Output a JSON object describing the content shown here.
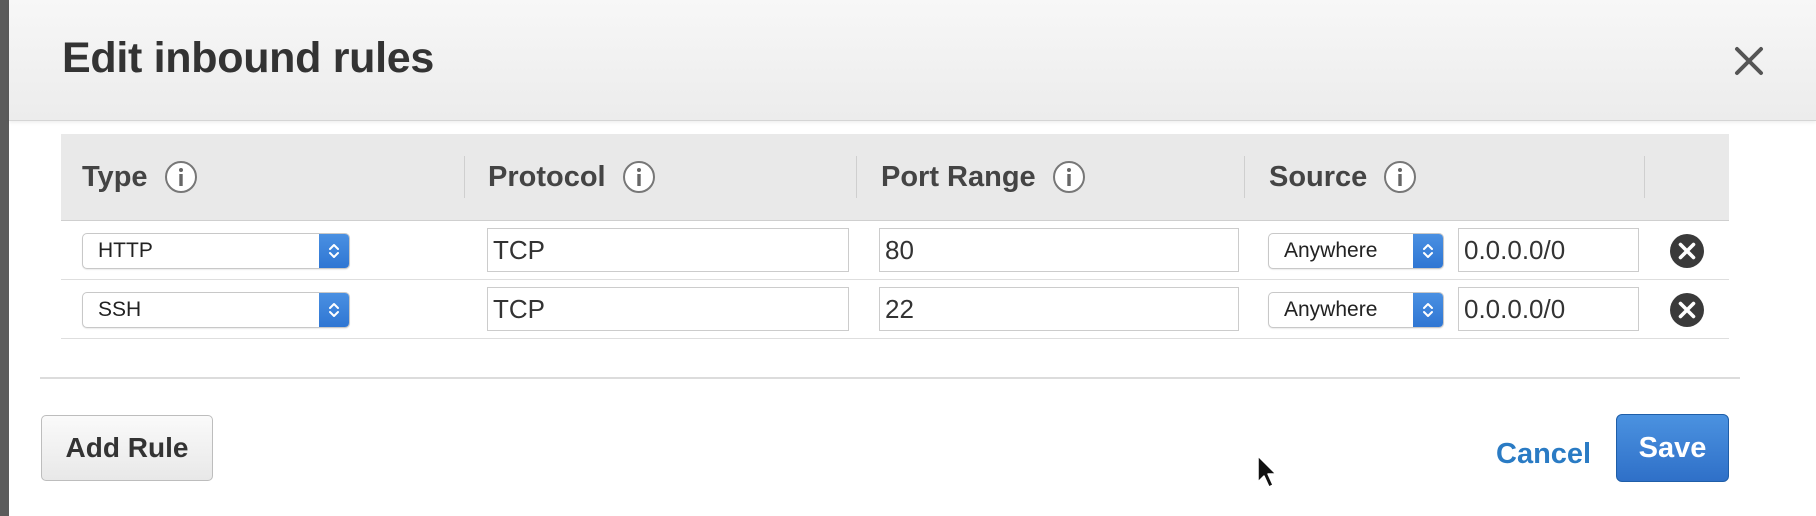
{
  "dialog": {
    "title": "Edit inbound rules",
    "close_icon": "close-icon"
  },
  "table": {
    "columns": [
      {
        "label": "Type",
        "icon": "info-icon"
      },
      {
        "label": "Protocol",
        "icon": "info-icon"
      },
      {
        "label": "Port Range",
        "icon": "info-icon"
      },
      {
        "label": "Source",
        "icon": "info-icon"
      }
    ],
    "rows": [
      {
        "type": "HTTP",
        "protocol": "TCP",
        "port_range": "80",
        "source": "Anywhere",
        "cidr": "0.0.0.0/0",
        "remove_icon": "remove-circle-icon"
      },
      {
        "type": "SSH",
        "protocol": "TCP",
        "port_range": "22",
        "source": "Anywhere",
        "cidr": "0.0.0.0/0",
        "remove_icon": "remove-circle-icon"
      }
    ]
  },
  "footer": {
    "add_rule_label": "Add Rule",
    "cancel_label": "Cancel",
    "save_label": "Save"
  },
  "colors": {
    "primary_button": "#3a80d6",
    "link": "#2a7bc4",
    "select_arrow": "#3b86dc",
    "header_bg": "#f2f2f2",
    "table_header_bg": "#e9e9e9"
  }
}
